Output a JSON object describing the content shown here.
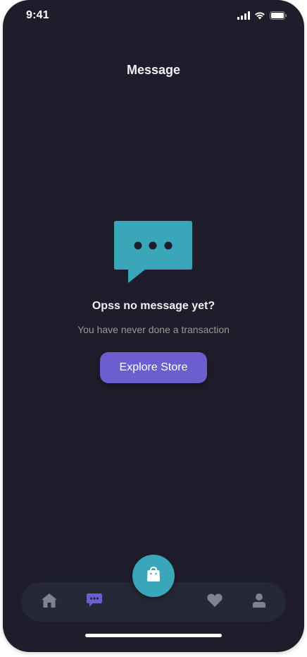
{
  "status_bar": {
    "time": "9:41",
    "signal_icon": "signal-icon",
    "wifi_icon": "wifi-icon",
    "battery_icon": "battery-icon"
  },
  "header": {
    "title": "Message"
  },
  "empty_state": {
    "icon": "chat-bubble-icon",
    "title": "Opss no message yet?",
    "subtitle": "You have never done a transaction",
    "button_label": "Explore Store"
  },
  "bottom_nav": {
    "active": "messages",
    "items": [
      {
        "id": "home",
        "icon": "home-icon"
      },
      {
        "id": "messages",
        "icon": "chat-icon"
      },
      {
        "id": "cart",
        "icon": "shopping-bag-icon"
      },
      {
        "id": "wishlist",
        "icon": "heart-icon"
      },
      {
        "id": "profile",
        "icon": "user-icon"
      }
    ]
  },
  "colors": {
    "background": "#1f1d2b",
    "nav_background": "#252836",
    "accent": "#6c5ecf",
    "secondary": "#39a6b9",
    "text_primary": "#f1f0f2",
    "text_secondary": "#999999",
    "icon_inactive": "#808191"
  }
}
